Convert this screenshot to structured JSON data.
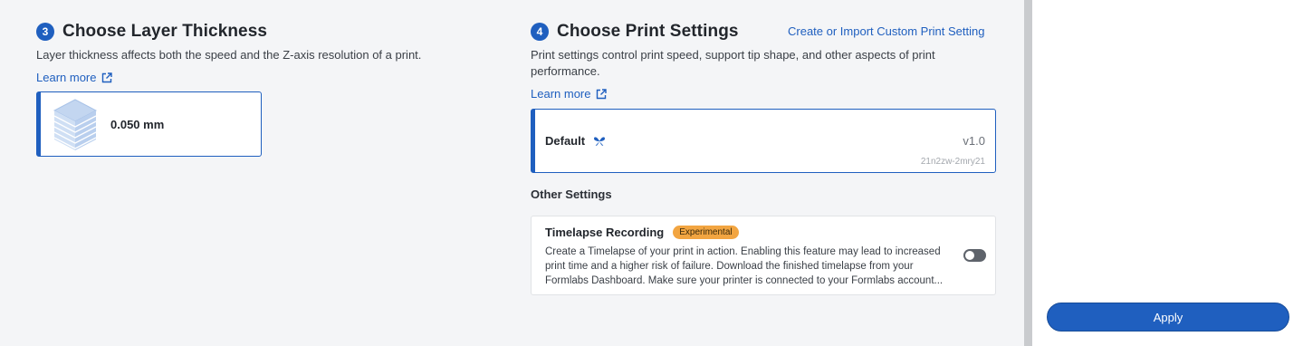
{
  "layer_section": {
    "step": "3",
    "title": "Choose Layer Thickness",
    "description": "Layer thickness affects both the speed and the Z-axis resolution of a print.",
    "learn_more": "Learn more",
    "learn_more_icon": "external-link-icon",
    "option": {
      "value": "0.050 mm",
      "icon": "layers-icon"
    }
  },
  "print_section": {
    "step": "4",
    "title": "Choose Print Settings",
    "custom_link": "Create or Import Custom Print Setting",
    "description_line1": "Print settings control print speed, support tip shape, and other aspects of print",
    "description_line2": "performance.",
    "learn_more": "Learn more",
    "selected_setting": {
      "name": "Default",
      "icon": "butterfly-icon",
      "version": "v1.0",
      "id": "21n2zw-2mry21"
    }
  },
  "other_settings": {
    "title": "Other Settings",
    "timelapse": {
      "title": "Timelapse Recording",
      "badge": "Experimental",
      "line1": "Create a Timelapse of your print in action. Enabling this feature may lead to increased",
      "line2": "print time and a higher risk of failure. Download the finished timelapse from your",
      "line3": "Formlabs Dashboard. Make sure your printer is connected to your Formlabs account...",
      "enabled": false
    }
  },
  "right_panel": {
    "apply_label": "Apply"
  },
  "colors": {
    "accent": "#1f5fbf",
    "badge": "#f2a541",
    "background": "#f4f5f7",
    "divider": "#c9cbce"
  }
}
